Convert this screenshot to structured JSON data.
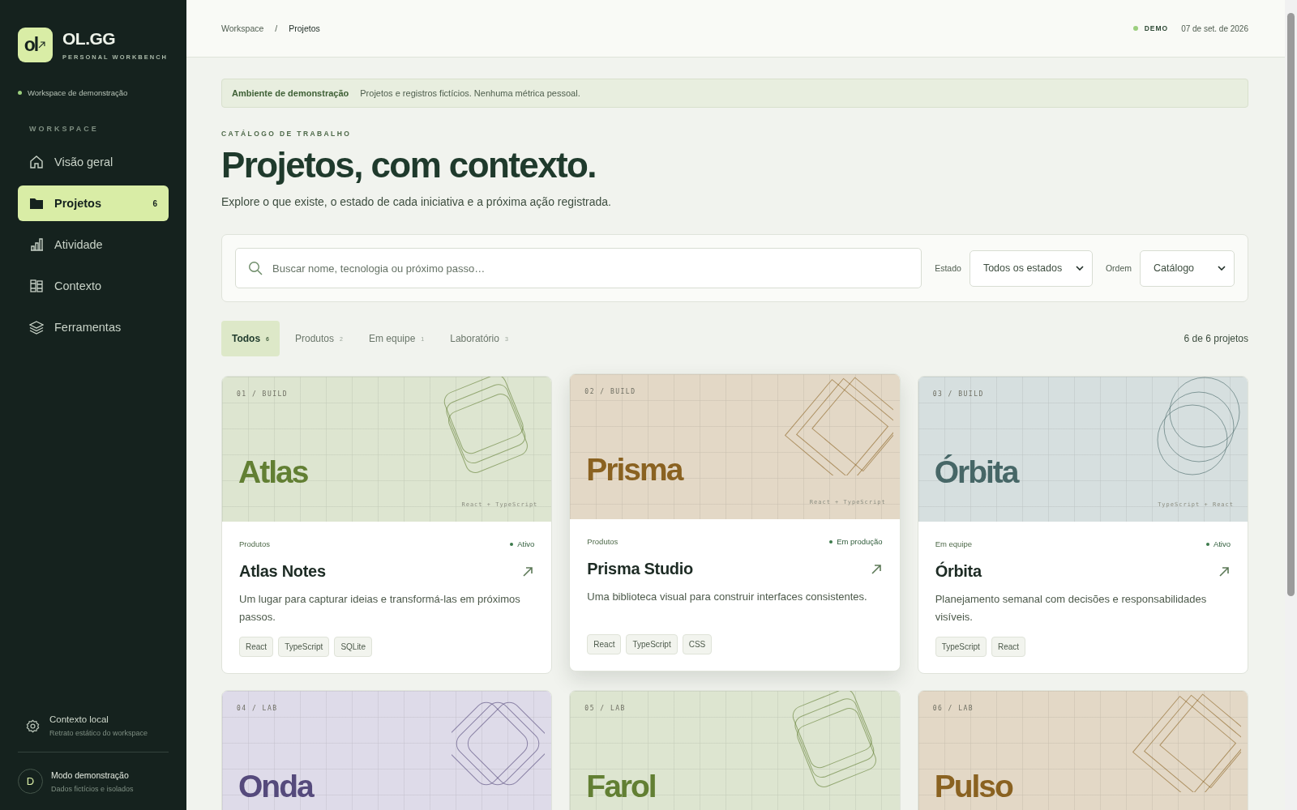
{
  "sidebar": {
    "logo_mark": "ol",
    "brand": "OL.GG",
    "tagline": "PERSONAL WORKBENCH",
    "workspace": "Workspace de demonstração",
    "section": "WORKSPACE",
    "items": [
      {
        "label": "Visão geral",
        "kind": "home",
        "selected": false
      },
      {
        "label": "Projetos",
        "kind": "folder",
        "selected": true,
        "count": "6"
      },
      {
        "label": "Atividade",
        "kind": "chart",
        "selected": false
      },
      {
        "label": "Contexto",
        "kind": "books",
        "selected": false
      },
      {
        "label": "Ferramentas",
        "kind": "layers",
        "selected": false
      }
    ],
    "footer": {
      "title": "Contexto local",
      "subtitle": "Retrato estático do workspace"
    },
    "user": {
      "initial": "D",
      "name": "Modo demonstração",
      "subtitle": "Dados fictícios e isolados"
    }
  },
  "header": {
    "breadcrumb": [
      "Workspace",
      "Projetos"
    ],
    "separator": "/",
    "badge": "DEMO",
    "date": "07 de set. de 2026"
  },
  "notice": {
    "title": "Ambiente de demonstração",
    "text": "Projetos e registros fictícios. Nenhuma métrica pessoal."
  },
  "eyebrow": "CATÁLOGO DE TRABALHO",
  "title": "Projetos, com contexto.",
  "subtitle": "Explore o que existe, o estado de cada iniciativa e a próxima ação registrada.",
  "search": {
    "placeholder": "Buscar nome, tecnologia ou próximo passo…"
  },
  "filters": [
    {
      "label": "Estado",
      "value": "Todos os estados"
    },
    {
      "label": "Ordem",
      "value": "Catálogo"
    }
  ],
  "tabs": [
    {
      "label": "Todos",
      "count": "6",
      "selected": true
    },
    {
      "label": "Produtos",
      "count": "2",
      "selected": false
    },
    {
      "label": "Em equipe",
      "count": "1",
      "selected": false
    },
    {
      "label": "Laboratório",
      "count": "3",
      "selected": false
    }
  ],
  "result_count": "6 de 6 projetos",
  "projects": [
    {
      "code": "01 / BUILD",
      "art_title": "Atlas",
      "stack": "React + TypeScript",
      "color": "#dde5d0",
      "kind": "squares",
      "highlighted": false,
      "category": "Produtos",
      "status": "Ativo",
      "name": "Atlas Notes",
      "description": "Um lugar para capturar ideias e transformá-las em próximos passos.",
      "tags": [
        "React",
        "TypeScript",
        "SQLite"
      ]
    },
    {
      "code": "02 / BUILD",
      "art_title": "Prisma",
      "stack": "React + TypeScript",
      "color": "#e3d8c6",
      "kind": "frames",
      "highlighted": true,
      "category": "Produtos",
      "status": "Em produção",
      "name": "Prisma Studio",
      "description": "Uma biblioteca visual para construir interfaces consistentes.",
      "tags": [
        "React",
        "TypeScript",
        "CSS"
      ]
    },
    {
      "code": "03 / BUILD",
      "art_title": "Órbita",
      "stack": "TypeScript + React",
      "color": "#d6dfdf",
      "kind": "circles",
      "highlighted": false,
      "category": "Em equipe",
      "status": "Ativo",
      "name": "Órbita",
      "description": "Planejamento semanal com decisões e responsabilidades visíveis.",
      "tags": [
        "TypeScript",
        "React"
      ]
    },
    {
      "code": "04 / LAB",
      "art_title": "Onda",
      "color": "#dedbe9",
      "kind": "diamonds",
      "highlighted": false
    },
    {
      "code": "05 / LAB",
      "art_title": "Farol",
      "color": "#dde5d0",
      "kind": "squares",
      "highlighted": false
    },
    {
      "code": "06 / LAB",
      "art_title": "Pulso",
      "color": "#e3d8c6",
      "kind": "frames",
      "highlighted": false
    }
  ]
}
